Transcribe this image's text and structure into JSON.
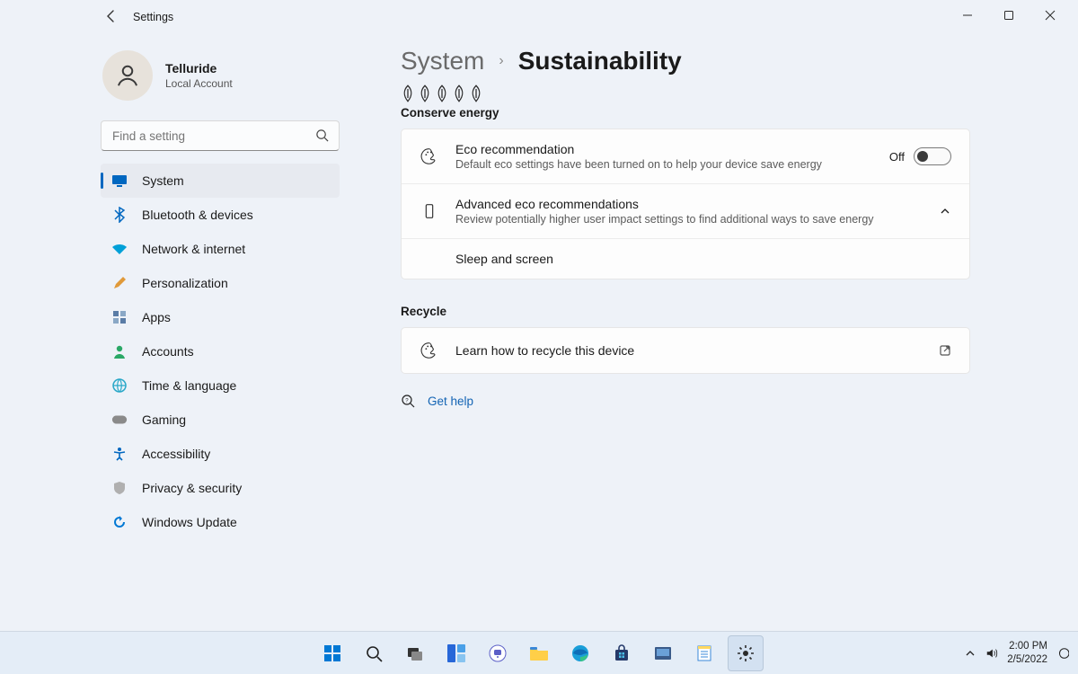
{
  "window": {
    "app_title": "Settings",
    "minimize": "Minimize",
    "maximize": "Maximize",
    "close": "Close"
  },
  "profile": {
    "username": "Telluride",
    "account_type": "Local Account"
  },
  "search": {
    "placeholder": "Find a setting"
  },
  "nav": {
    "items": [
      {
        "label": "System",
        "icon": "monitor",
        "color": "#0067c0"
      },
      {
        "label": "Bluetooth & devices",
        "icon": "bluetooth",
        "color": "#0067c0"
      },
      {
        "label": "Network & internet",
        "icon": "wifi",
        "color": "#0094d8"
      },
      {
        "label": "Personalization",
        "icon": "pencil",
        "color": "#e09a3a"
      },
      {
        "label": "Apps",
        "icon": "grid",
        "color": "#5a7ca6"
      },
      {
        "label": "Accounts",
        "icon": "person",
        "color": "#2aa866"
      },
      {
        "label": "Time & language",
        "icon": "globe",
        "color": "#2aa8c8"
      },
      {
        "label": "Gaming",
        "icon": "gamepad",
        "color": "#8a8a8a"
      },
      {
        "label": "Accessibility",
        "icon": "accessibility",
        "color": "#0067c0"
      },
      {
        "label": "Privacy & security",
        "icon": "shield",
        "color": "#8a8a8a"
      },
      {
        "label": "Windows Update",
        "icon": "update",
        "color": "#0078d4"
      }
    ],
    "active_index": 0
  },
  "breadcrumb": {
    "parent": "System",
    "current": "Sustainability"
  },
  "conserve": {
    "heading": "Conserve energy",
    "rows": [
      {
        "title": "Eco recommendation",
        "desc": "Default eco settings have been turned on to help your device save energy",
        "state_label": "Off",
        "toggle": false
      },
      {
        "title": "Advanced eco recommendations",
        "desc": "Review potentially higher user impact settings to find additional ways to save energy",
        "expandable": true
      },
      {
        "title": "Sleep and screen",
        "desc": ""
      }
    ]
  },
  "recycle": {
    "heading": "Recycle",
    "row_title": "Learn how to recycle this device"
  },
  "help": {
    "label": "Get help"
  },
  "tray": {
    "time": "2:00 PM",
    "date": "2/5/2022"
  }
}
